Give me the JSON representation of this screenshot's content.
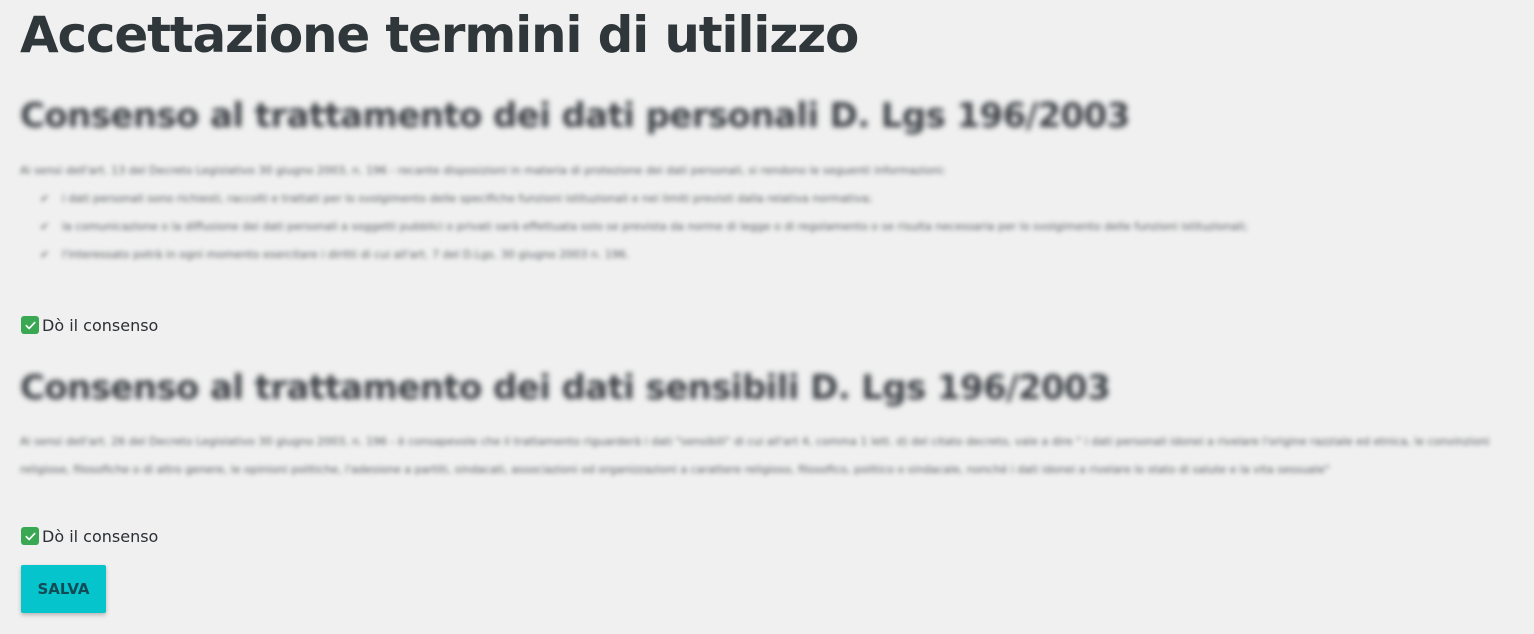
{
  "page": {
    "title": "Accettazione termini di utilizzo"
  },
  "sections": [
    {
      "heading": "Consenso al trattamento dei dati personali D. Lgs 196/2003",
      "intro": "Ai sensi dell'art. 13 del Decreto Legislativo 30 giugno 2003, n. 196 - recante disposizioni in materia di protezione dei dati personali, si rendono le seguenti informazioni:",
      "bullets": [
        "i dati personali sono richiesti, raccolti e trattati per lo svolgimento delle specifiche funzioni istituzionali e nei limiti previsti dalla relativa normativa;",
        "la comunicazione o la diffusione dei dati personali a soggetti pubblici o privati sarà effettuata solo se prevista da norme di legge o di regolamento o se risulta necessaria per lo svolgimento delle funzioni istituzionali;",
        "l'interessato potrà in ogni momento esercitare i diritti di cui all'art. 7 del D.Lgs. 30 giugno 2003 n. 196."
      ],
      "consent": {
        "label": "Dò il consenso",
        "checked": true
      }
    },
    {
      "heading": "Consenso al trattamento dei dati sensibili D. Lgs 196/2003",
      "intro": "Ai sensi dell'art. 26 del Decreto Legislativo 30 giugno 2003, n. 196 - è consapevole che il trattamento riguarderà i dati \"sensibili\" di cui all'art 4, comma 1 lett. d) del citato decreto, vale a dire \" i dati personali idonei a rivelare l'origine razziale ed etnica, le convinzioni religiose, filosofiche o di altro genere, le opinioni politiche, l'adesione a partiti, sindacati, associazioni od organizzazioni a carattere religioso, filosofico, politico o sindacale, nonché i dati idonei a rivelare lo stato di salute e la vita sessuale\"",
      "consent": {
        "label": "Dò il consenso",
        "checked": true
      }
    }
  ],
  "actions": {
    "save_label": "SALVA"
  },
  "colors": {
    "background": "#f0f0f0",
    "checkbox": "#3aa853",
    "save_button": "#06c4cc",
    "save_text": "#124a55"
  },
  "icons": {
    "checkbox_checked": "check-icon"
  }
}
